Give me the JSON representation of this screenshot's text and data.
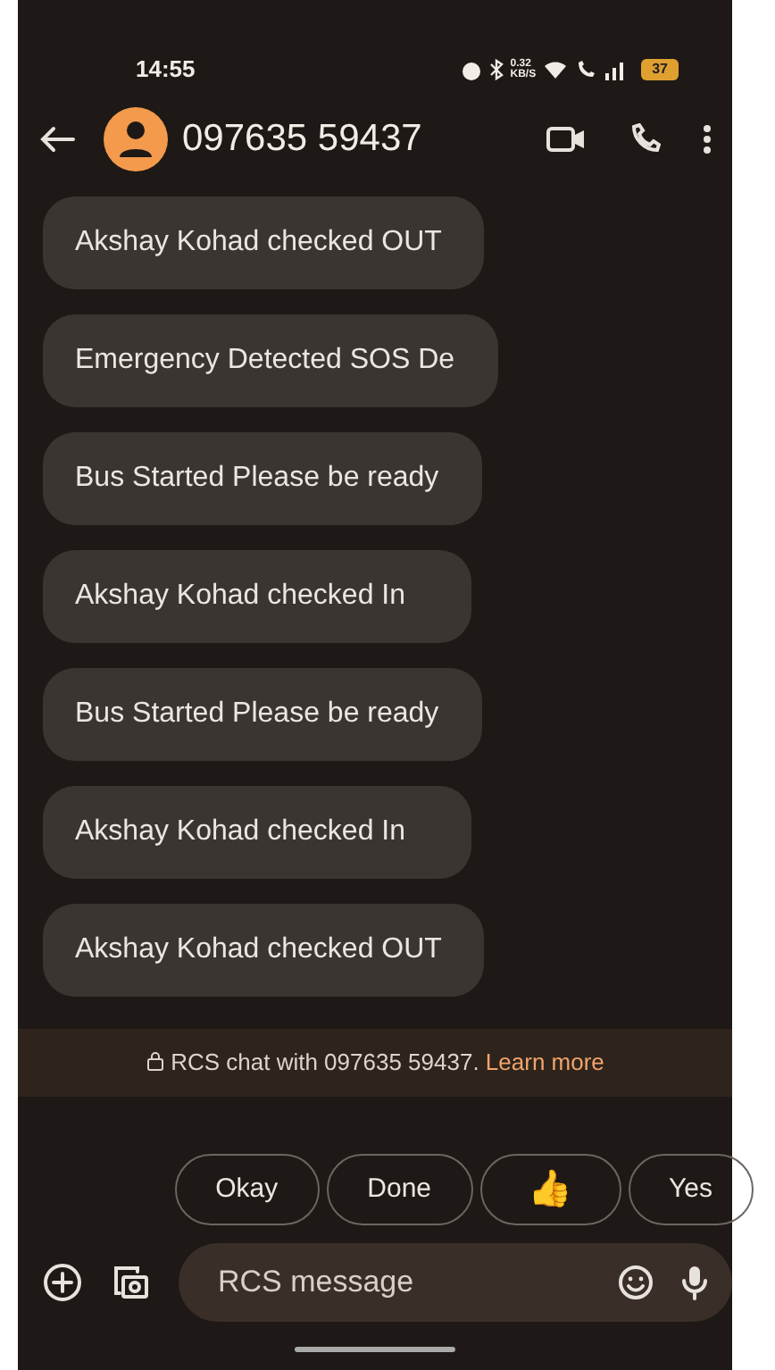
{
  "status_bar": {
    "time": "14:55",
    "data_speed": "0.32",
    "data_unit": "KB/S",
    "battery": "37"
  },
  "header": {
    "contact": "097635 59437"
  },
  "messages": [
    {
      "text": "Akshay Kohad checked OUT"
    },
    {
      "text": "Emergency Detected SOS De"
    },
    {
      "text": "Bus Started Please be ready"
    },
    {
      "text": "Akshay Kohad checked In"
    },
    {
      "text": "Bus Started Please be ready"
    },
    {
      "text": "Akshay Kohad checked In"
    },
    {
      "text": "Akshay Kohad checked OUT"
    }
  ],
  "rcs_banner": {
    "text": "RCS chat with 097635 59437.",
    "link": "Learn more"
  },
  "suggestions": [
    {
      "kind": "text",
      "label": "Okay"
    },
    {
      "kind": "text",
      "label": "Done"
    },
    {
      "kind": "emoji",
      "label": "👍"
    },
    {
      "kind": "text",
      "label": "Yes"
    }
  ],
  "composer": {
    "placeholder": "RCS message"
  }
}
